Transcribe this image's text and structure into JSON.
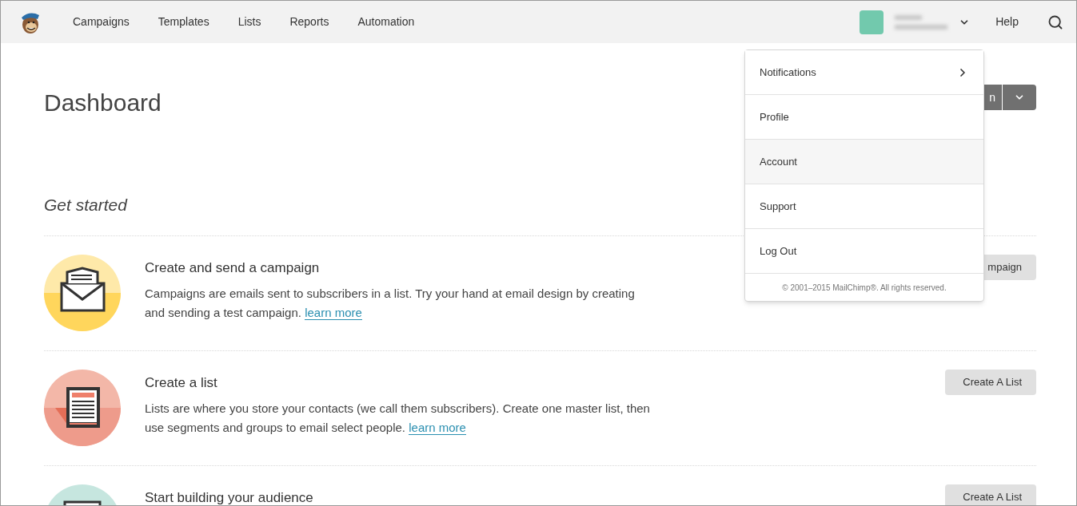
{
  "nav": {
    "items": [
      {
        "label": "Campaigns"
      },
      {
        "label": "Templates"
      },
      {
        "label": "Lists"
      },
      {
        "label": "Reports"
      },
      {
        "label": "Automation"
      }
    ],
    "help": "Help"
  },
  "page": {
    "title": "Dashboard",
    "action_button": "n"
  },
  "get_started": {
    "heading": "Get started",
    "rows": [
      {
        "kind": "campaign",
        "title": "Create and send a campaign",
        "text": "Campaigns are emails sent to subscribers in a list. Try your hand at email design by creating and sending a test campaign.",
        "link": "learn more",
        "button": "mpaign"
      },
      {
        "kind": "list",
        "title": "Create a list",
        "text": "Lists are where you store your contacts (we call them subscribers). Create one master list, then use segments and groups to email select people.",
        "link": "learn more",
        "button": "Create A List"
      },
      {
        "kind": "audience",
        "title": "Start building your audience",
        "button": "Create A List"
      }
    ]
  },
  "account_menu": {
    "items": [
      {
        "label": "Notifications",
        "submenu": true,
        "highlighted": false
      },
      {
        "label": "Profile",
        "submenu": false,
        "highlighted": false
      },
      {
        "label": "Account",
        "submenu": false,
        "highlighted": true
      },
      {
        "label": "Support",
        "submenu": false,
        "highlighted": false
      },
      {
        "label": "Log Out",
        "submenu": false,
        "highlighted": false
      }
    ],
    "footer": "© 2001–2015 MailChimp®. All rights reserved."
  }
}
